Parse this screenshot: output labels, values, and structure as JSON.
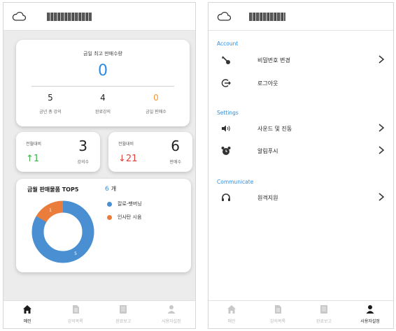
{
  "left": {
    "title": "",
    "total_card": {
      "title": "금일 최고 판매수량",
      "value": "0",
      "stats": [
        {
          "value": "5",
          "label": "금년 총 강의",
          "color": "#222222"
        },
        {
          "value": "4",
          "label": "완료강의",
          "color": "#222222"
        },
        {
          "value": "0",
          "label": "금일 판매수",
          "color": "#f0962e"
        }
      ]
    },
    "mom_left": {
      "label": "전월대비",
      "value": "3",
      "change": "↑1",
      "change_color": "#3cb54a",
      "unit": "강의수"
    },
    "mom_right": {
      "label": "전월대비",
      "value": "6",
      "change": "↓21",
      "change_color": "#e2413a",
      "unit": "판매수"
    },
    "top5": {
      "title": "금월 판매물품 TOP5",
      "count": "6",
      "count_unit": "개",
      "chart_data": {
        "type": "pie",
        "categories": [
          "칼로-팻버닝",
          "인사탄 시음"
        ],
        "values": [
          5,
          1
        ],
        "colors": [
          "#4a8fd1",
          "#ea7d3c"
        ]
      }
    },
    "nav": [
      {
        "label": "메인",
        "icon": "home-icon",
        "active": true
      },
      {
        "label": "강의목록",
        "icon": "document-icon",
        "active": false
      },
      {
        "label": "완료보고",
        "icon": "report-icon",
        "active": false
      },
      {
        "label": "사용자설정",
        "icon": "user-icon",
        "active": false
      }
    ]
  },
  "right": {
    "title": "",
    "sections": [
      {
        "header": "Account",
        "items": [
          {
            "icon": "key-icon",
            "label": "비밀번호 변경",
            "chevron": true
          },
          {
            "icon": "logout-icon",
            "label": "로그아웃",
            "chevron": false
          }
        ]
      },
      {
        "header": "Settings",
        "items": [
          {
            "icon": "speaker-icon",
            "label": "사운드 및 진동",
            "chevron": true
          },
          {
            "icon": "alarm-icon",
            "label": "알림푸시",
            "chevron": true
          }
        ]
      },
      {
        "header": "Communicate",
        "items": [
          {
            "icon": "headset-icon",
            "label": "원격지원",
            "chevron": true
          }
        ]
      }
    ],
    "nav": [
      {
        "label": "메인",
        "icon": "home-icon",
        "active": false
      },
      {
        "label": "강의목록",
        "icon": "document-icon",
        "active": false
      },
      {
        "label": "완료보고",
        "icon": "report-icon",
        "active": false
      },
      {
        "label": "사용자설정",
        "icon": "user-icon",
        "active": true
      }
    ]
  }
}
